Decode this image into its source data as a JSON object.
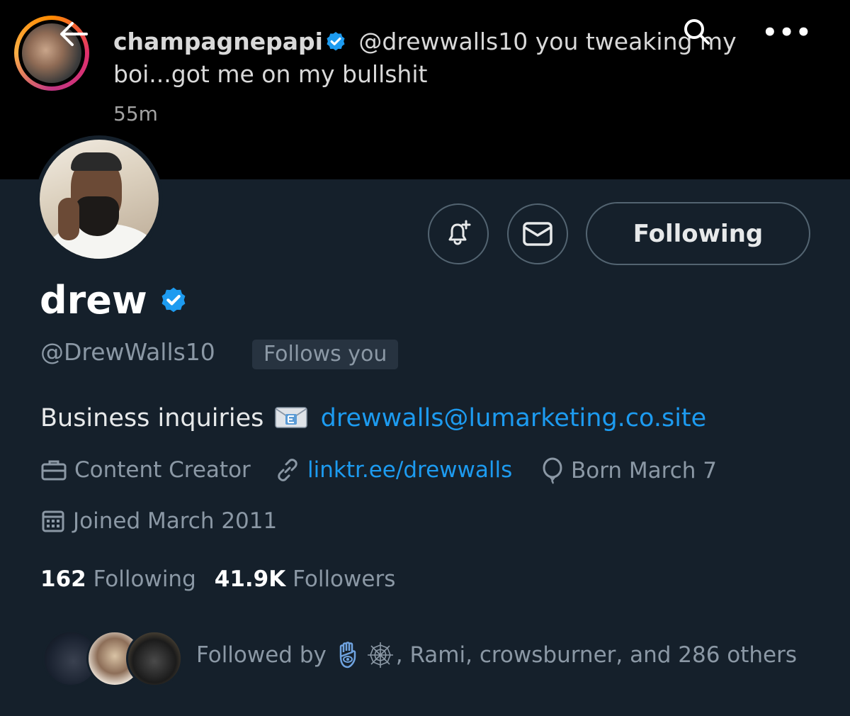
{
  "banner": {
    "username": "champagnepapi",
    "tweet_text": "@drewwalls10 you tweaking my boi...got me on my bullshit",
    "time": "55m"
  },
  "profile": {
    "display_name": "drew",
    "handle": "@DrewWalls10",
    "follows_you": "Follows you",
    "bio_text": "Business inquiries",
    "bio_email": "drewwalls@lumarketing.co.site",
    "category": "Content Creator",
    "website": "linktr.ee/drewwalls",
    "birthday": "Born March 7",
    "joined": "Joined March 2011",
    "following_count": "162",
    "following_label": "Following",
    "followers_count": "41.9K",
    "followers_label": "Followers",
    "followed_by_prefix": "Followed by",
    "followed_by_rest": ", Rami, crowsburner, and 286 others"
  },
  "actions": {
    "following_button": "Following"
  },
  "icons": {
    "back": "back-arrow-icon",
    "search": "search-icon",
    "more": "more-icon",
    "verified": "verified-badge-icon",
    "notify": "bell-plus-icon",
    "message": "envelope-icon",
    "job": "briefcase-icon",
    "link": "link-icon",
    "birthday": "balloon-icon",
    "joined": "calendar-icon"
  },
  "colors": {
    "background": "#15202b",
    "banner": "#000000",
    "accent": "#1d9bf0",
    "muted": "#8b98a5"
  }
}
